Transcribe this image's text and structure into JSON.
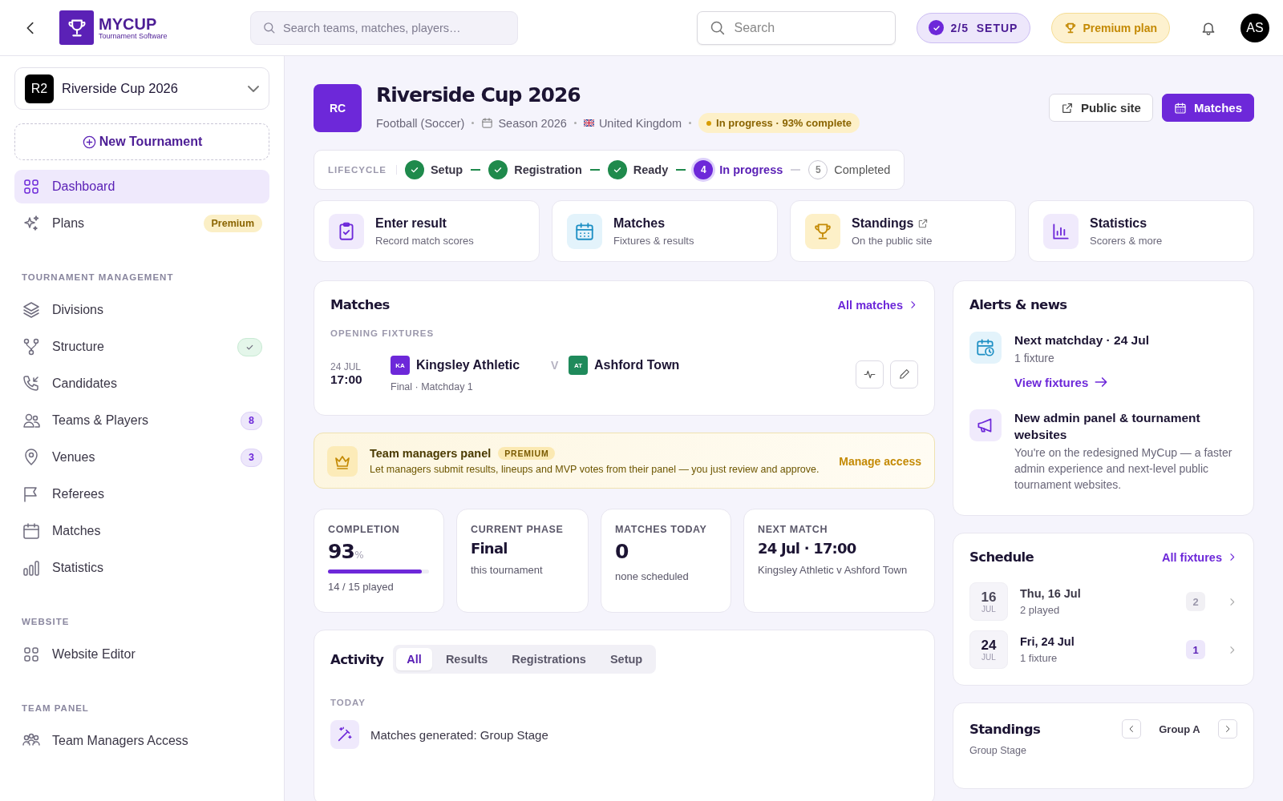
{
  "topbar": {
    "logo": {
      "title": "MYCUP",
      "subtitle": "Tournament Software"
    },
    "search": {
      "placeholder": "Search teams, matches, players…"
    },
    "search_small": {
      "placeholder": "Search"
    },
    "setup": {
      "label": "2/5  SETUP"
    },
    "plan": {
      "label": "Premium plan"
    },
    "avatar": "AS"
  },
  "sidebar": {
    "tournament": {
      "badge": "R2",
      "name": "Riverside Cup 2026"
    },
    "new_button": "New Tournament",
    "items": [
      {
        "label": "Dashboard",
        "selected": true
      },
      {
        "label": "Plans",
        "selected": false,
        "badge": {
          "kind": "premium",
          "text": "Premium"
        }
      }
    ],
    "sections": [
      {
        "title": "TOURNAMENT MANAGEMENT",
        "items": [
          {
            "label": "Divisions",
            "selected": false
          },
          {
            "label": "Structure",
            "selected": false,
            "badge": {
              "kind": "check"
            }
          },
          {
            "label": "Candidates",
            "selected": false
          },
          {
            "label": "Teams & Players",
            "selected": false,
            "badge": {
              "kind": "count",
              "text": "8"
            }
          },
          {
            "label": "Venues",
            "selected": false,
            "badge": {
              "kind": "count",
              "text": "3"
            }
          },
          {
            "label": "Referees",
            "selected": false
          },
          {
            "label": "Matches",
            "selected": false
          },
          {
            "label": "Statistics",
            "selected": false
          }
        ]
      },
      {
        "title": "WEBSITE",
        "items": [
          {
            "label": "Website Editor",
            "selected": false
          }
        ]
      },
      {
        "title": "TEAM PANEL",
        "items": [
          {
            "label": "Team Managers Access",
            "selected": false
          }
        ]
      }
    ]
  },
  "header": {
    "badge": "RC",
    "title": "Riverside Cup 2026",
    "meta": [
      "Football (Soccer)",
      "Season 2026",
      "United Kingdom"
    ],
    "status": "In progress · 93% complete",
    "buttons": [
      {
        "label": "Public site",
        "kind": "secondary"
      },
      {
        "label": "Matches",
        "kind": "primary"
      }
    ]
  },
  "lifecycle": {
    "label": "LIFECYCLE",
    "steps": [
      {
        "label": "Setup",
        "done": true,
        "current": false
      },
      {
        "label": "Registration",
        "done": true,
        "current": false
      },
      {
        "label": "Ready",
        "done": true,
        "current": false
      },
      {
        "label": "In progress",
        "done": false,
        "current": true,
        "number": "4"
      },
      {
        "label": "Completed",
        "done": false,
        "current": false,
        "number": "5"
      }
    ]
  },
  "quick_actions": [
    {
      "title": "Enter result",
      "subtitle": "Record match scores",
      "external": false
    },
    {
      "title": "Matches",
      "subtitle": "Fixtures & results",
      "external": false
    },
    {
      "title": "Standings",
      "subtitle": "On the public site",
      "external": true
    },
    {
      "title": "Statistics",
      "subtitle": "Scorers & more",
      "external": false
    }
  ],
  "matches": {
    "title": "Matches",
    "link": "All matches",
    "section": "OPENING FIXTURES",
    "fixtures": [
      {
        "date": "24 JUL",
        "time": "17:00",
        "home": {
          "abbr": "KA",
          "name": "Kingsley Athletic",
          "color": "#6d28d9"
        },
        "versus": "V",
        "away": {
          "abbr": "AT",
          "name": "Ashford Town",
          "color": "#1f8a5b"
        },
        "meta": "Final · Matchday 1"
      }
    ]
  },
  "banner": {
    "title": "Team managers panel",
    "tag": "PREMIUM",
    "text": "Let managers submit results, lineups and MVP votes from their panel — you just review and approve.",
    "action": "Manage access"
  },
  "stats": [
    {
      "label": "COMPLETION",
      "value": "93",
      "unit": "%",
      "level": 0.93,
      "sub": "14 / 15 played"
    },
    {
      "label": "CURRENT PHASE",
      "value": "Final",
      "sub": "this tournament"
    },
    {
      "label": "MATCHES TODAY",
      "value": "0",
      "sub": "none scheduled"
    },
    {
      "label": "NEXT MATCH",
      "value": "24 Jul · 17:00",
      "sub": "Kingsley Athletic v Ashford Town"
    }
  ],
  "activity": {
    "title": "Activity",
    "tabs": [
      {
        "label": "All",
        "selected": true
      },
      {
        "label": "Results",
        "selected": false
      },
      {
        "label": "Registrations",
        "selected": false
      },
      {
        "label": "Setup",
        "selected": false
      }
    ],
    "group": "TODAY",
    "items": [
      "Matches generated: Group Stage"
    ]
  },
  "alerts": {
    "title": "Alerts & news",
    "items": [
      {
        "title": "Next matchday · 24 Jul",
        "text": "1 fixture",
        "link": "View fixtures"
      },
      {
        "title": "New admin panel & tournament websites",
        "text": "You're on the redesigned MyCup — a faster admin experience and next-level public tournament websites."
      }
    ]
  },
  "schedule": {
    "title": "Schedule",
    "link": "All fixtures",
    "days": [
      {
        "day": "16",
        "month": "JUL",
        "title": "Thu, 16 Jul",
        "sub": "2 played",
        "count": "2",
        "upcoming": false
      },
      {
        "day": "24",
        "month": "JUL",
        "title": "Fri, 24 Jul",
        "sub": "1 fixture",
        "count": "1",
        "upcoming": true
      }
    ]
  },
  "standings": {
    "title": "Standings",
    "sub": "Group Stage",
    "group": "Group A"
  }
}
